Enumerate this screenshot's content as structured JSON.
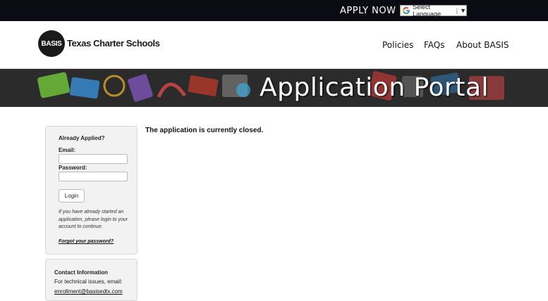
{
  "topbar": {
    "apply_label": "APPLY NOW",
    "language_label": "Select Language",
    "language_arrow": "▼",
    "language_sep": "|"
  },
  "header": {
    "logo_mark": "BASIS",
    "logo_text": "Texas Charter Schools",
    "nav": [
      "Policies",
      "FAQs",
      "About BASIS"
    ]
  },
  "banner": {
    "title": "Application Portal"
  },
  "login": {
    "title": "Already Applied?",
    "email_label": "Email:",
    "password_label": "Password:",
    "button_label": "Login",
    "note": "If you have already started an application, please login to your account to continue.",
    "forgot_label": "Forgot your password?"
  },
  "contact": {
    "title": "Contact Information",
    "text": "For technical issues, email:",
    "email": "enrollment@basisedtx.com"
  },
  "main": {
    "message": "The application is currently closed."
  },
  "colors": {
    "topbar": "#0b0b14",
    "banner": "#2a2a2a",
    "panel": "#f2f2f2"
  }
}
